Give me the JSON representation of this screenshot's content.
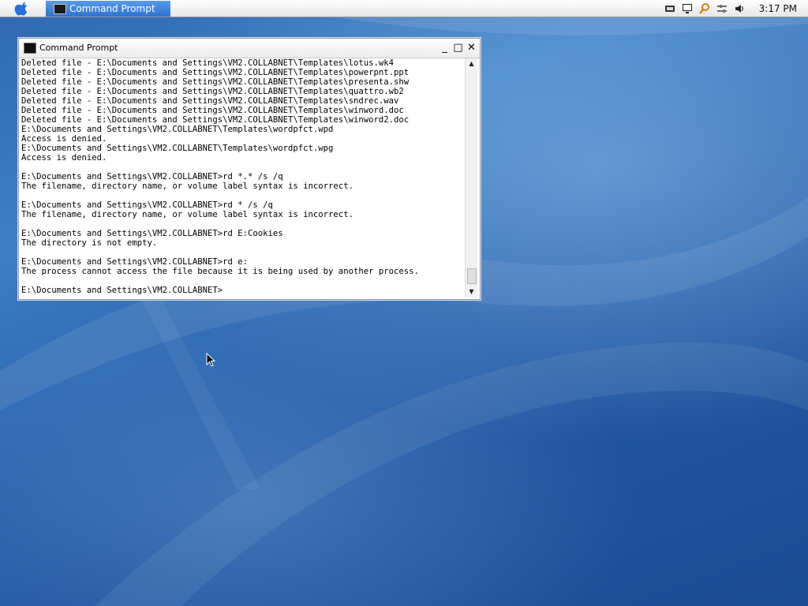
{
  "taskbar": {
    "task_title": "Command Prompt",
    "clock": "3:17 PM",
    "tray_icons": [
      "display-icon",
      "monitor-icon",
      "search-icon",
      "settings-icon",
      "volume-icon"
    ]
  },
  "window": {
    "title": "Command Prompt",
    "minimize": "_",
    "maximize": "□",
    "close": "✕"
  },
  "terminal": {
    "lines": [
      "Deleted file - E:\\Documents and Settings\\VM2.COLLABNET\\Templates\\lotus.wk4",
      "Deleted file - E:\\Documents and Settings\\VM2.COLLABNET\\Templates\\powerpnt.ppt",
      "Deleted file - E:\\Documents and Settings\\VM2.COLLABNET\\Templates\\presenta.shw",
      "Deleted file - E:\\Documents and Settings\\VM2.COLLABNET\\Templates\\quattro.wb2",
      "Deleted file - E:\\Documents and Settings\\VM2.COLLABNET\\Templates\\sndrec.wav",
      "Deleted file - E:\\Documents and Settings\\VM2.COLLABNET\\Templates\\winword.doc",
      "Deleted file - E:\\Documents and Settings\\VM2.COLLABNET\\Templates\\winword2.doc",
      "E:\\Documents and Settings\\VM2.COLLABNET\\Templates\\wordpfct.wpd",
      "Access is denied.",
      "E:\\Documents and Settings\\VM2.COLLABNET\\Templates\\wordpfct.wpg",
      "Access is denied.",
      "",
      "E:\\Documents and Settings\\VM2.COLLABNET>rd *.* /s /q",
      "The filename, directory name, or volume label syntax is incorrect.",
      "",
      "E:\\Documents and Settings\\VM2.COLLABNET>rd * /s /q",
      "The filename, directory name, or volume label syntax is incorrect.",
      "",
      "E:\\Documents and Settings\\VM2.COLLABNET>rd E:Cookies",
      "The directory is not empty.",
      "",
      "E:\\Documents and Settings\\VM2.COLLABNET>rd e:",
      "The process cannot access the file because it is being used by another process.",
      "",
      "E:\\Documents and Settings\\VM2.COLLABNET>"
    ]
  },
  "colors": {
    "taskbar_active": "#2f72d2",
    "desktop": "#2a64ad"
  }
}
